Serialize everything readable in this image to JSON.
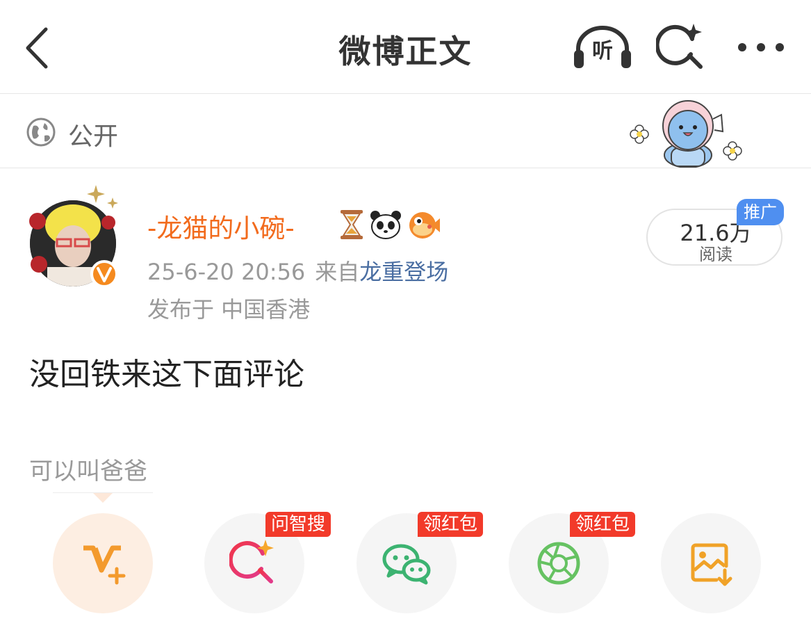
{
  "header": {
    "title": "微博正文",
    "listen_label": "听"
  },
  "visibility": {
    "label": "公开"
  },
  "post": {
    "username": "-龙猫的小碗-",
    "badges": [
      "hourglass-emoji",
      "panda-emoji",
      "pufferfish-emoji"
    ],
    "verified": true,
    "timestamp": "25-6-20 20:56",
    "source_prefix": "来自",
    "source_client": "龙重登场",
    "location": "发布于 中国香港",
    "reads_count": "21.6万",
    "reads_label": "阅读",
    "promo_tag": "推广",
    "text": "没回铁来这下面评论",
    "comment_hint": "可以叫爸爸"
  },
  "share_actions": [
    {
      "icon": "v-plus-icon",
      "badge": ""
    },
    {
      "icon": "ai-search-icon",
      "badge": "问智搜"
    },
    {
      "icon": "wechat-icon",
      "badge": "领红包"
    },
    {
      "icon": "moments-icon",
      "badge": "领红包"
    },
    {
      "icon": "save-image-icon",
      "badge": ""
    }
  ],
  "colors": {
    "username": "#f26b1d",
    "client_link": "#4a6ea2",
    "badge_red": "#f23a2a",
    "promo_blue": "#4f8ff0"
  }
}
